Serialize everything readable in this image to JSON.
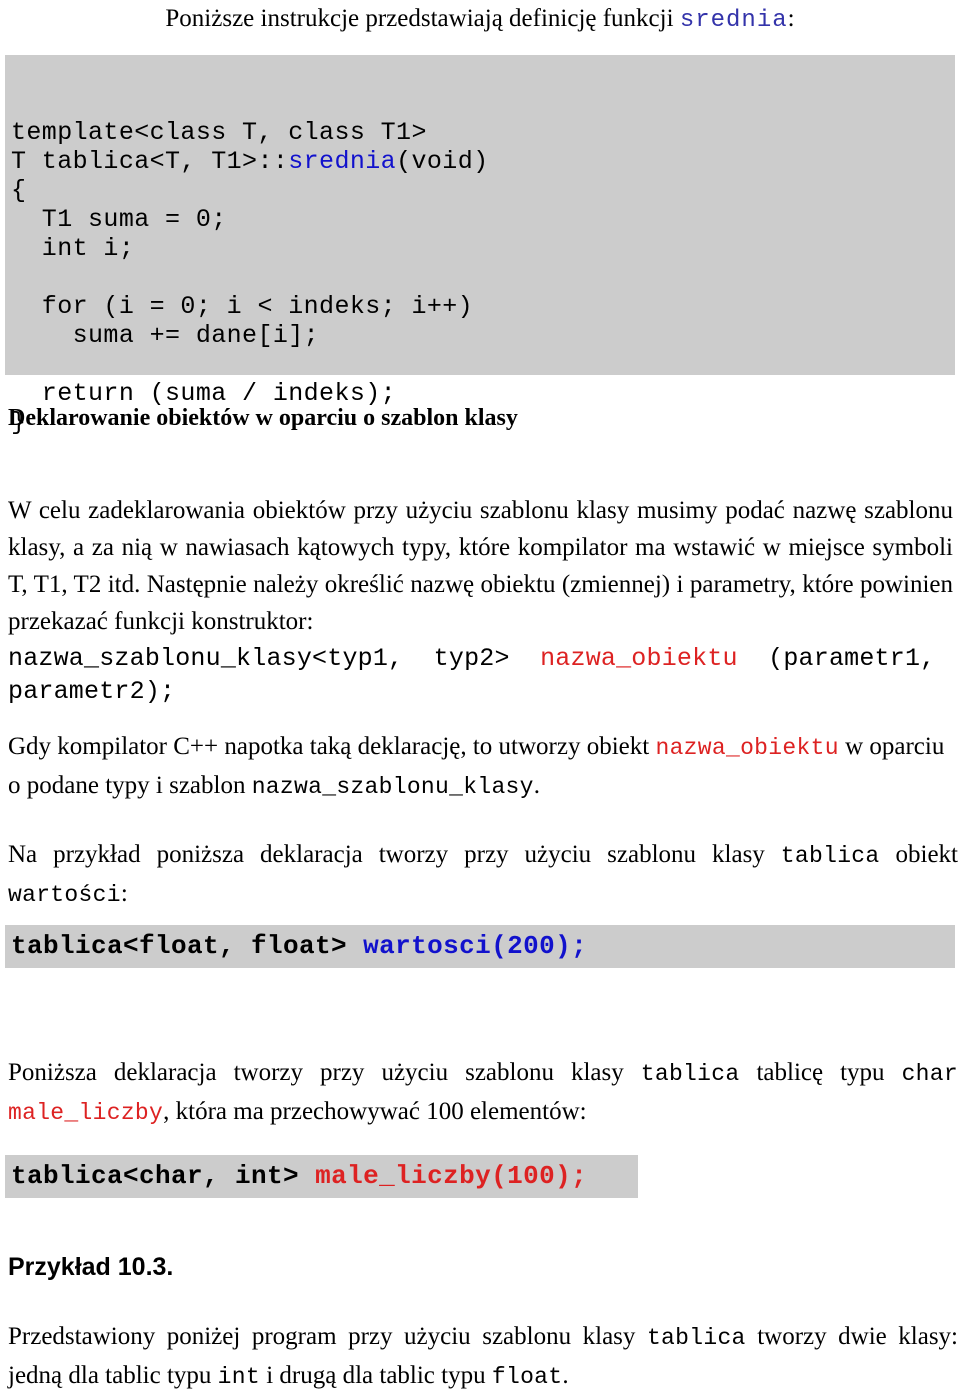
{
  "document": {
    "intro": {
      "text_before": "Poniższe instrukcje przedstawiają definicję funkcji ",
      "code_name": "srednia",
      "text_after": ":"
    },
    "code_block_srednia": {
      "line1": "template<class T, class T1>",
      "line2_pre": "T tablica<T, T1>::",
      "line2_name": "srednia",
      "line2_post": "(void)",
      "line3": "{",
      "line4": "  T1 suma = 0;",
      "line5": "  int i;",
      "line6": "",
      "line7": "  for (i = 0; i < indeks; i++)",
      "line8": "    suma += dane[i];",
      "line9": "",
      "line10": "  return (suma / indeks);",
      "line11": "}"
    },
    "heading_deklarowanie": "Deklarowanie obiektów w oparciu o szablon klasy",
    "para_w_celu": "W celu zadeklarowania obiektów przy użyciu szablonu klasy musimy podać nazwę szablonu klasy, a za nią w nawiasach kątowych typy, które kompilator ma wstawić w miejsce symboli T, T1, T2 itd. Następnie należy określić nazwę obiektu (zmiennej) i parametry, które powinien przekazać funkcji konstruktor:",
    "decl_nazwa_szablonu": {
      "part1": "nazwa_szablonu_klasy<typ1,  typ2>  ",
      "part2_red": "nazwa_obiektu",
      "part3": "  (parametr1,\nparametr2);"
    },
    "para_gdy": {
      "t1": "Gdy kompilator C++ napotka taką deklarację, to utworzy obiekt ",
      "c1": "nazwa_obiektu",
      "t2": " w oparciu o podane typy i szablon ",
      "c2": "nazwa_szablonu_klasy",
      "t3": "."
    },
    "para_na_przyklad": {
      "t1": "Na przykład poniższa deklaracja tworzy przy użyciu szablonu klasy ",
      "c1": "tablica",
      "t2": " obiekt ",
      "c2": "wartości",
      "t3": ":"
    },
    "code_block_wartosci": {
      "pre": "tablica<float, float> ",
      "name": "wartosci(200);"
    },
    "para_ponizsza_deklaracja": {
      "t1": "Poniższa deklaracja tworzy przy użyciu szablonu klasy ",
      "c1": "tablica",
      "t2": " tablicę typu ",
      "c2": "char ",
      "c3": "male_liczby",
      "t3": ", która ma przechowywać 100 elementów:"
    },
    "code_block_male_liczby": {
      "pre": "tablica<char, int> ",
      "name": "male_liczby(100);"
    },
    "heading_przyklad": "Przykład 10.3.",
    "para_przedstawiony": {
      "t1": "Przedstawiony poniżej program przy użyciu szablonu klasy ",
      "c1": "tablica",
      "t2": " tworzy dwie klasy: jedną dla tablic typu ",
      "c2": "int",
      "t3": " i drugą dla tablic typu ",
      "c3": "float",
      "t4": "."
    },
    "colors": {
      "code_background": "#cccccc",
      "identifier_blue": "#1111cc",
      "identifier_red": "#dd2222",
      "text": "#000000",
      "page_background": "#ffffff"
    }
  }
}
